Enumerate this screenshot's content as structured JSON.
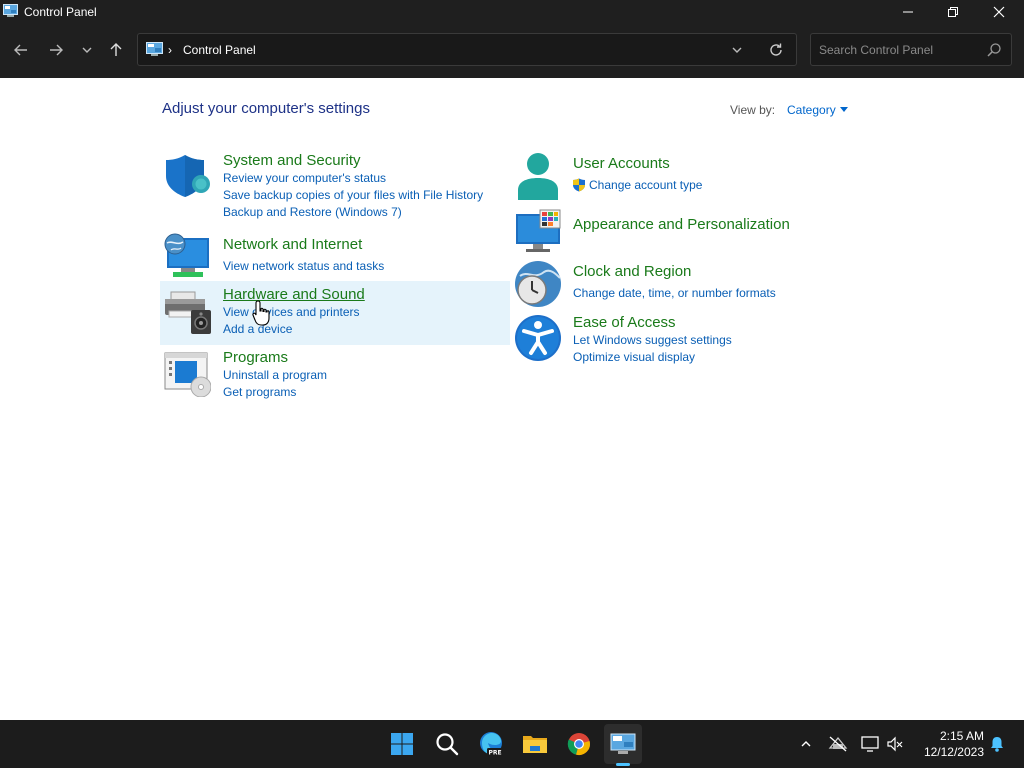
{
  "window": {
    "title": "Control Panel"
  },
  "address": {
    "breadcrumb": "Control Panel",
    "search_placeholder": "Search Control Panel"
  },
  "content": {
    "heading": "Adjust your computer's settings",
    "view_by_label": "View by:",
    "view_by_value": "Category",
    "left_categories": [
      {
        "title": "System and Security",
        "icon": "shield-icon",
        "links": [
          "Review your computer's status",
          "Save backup copies of your files with File History",
          "Backup and Restore (Windows 7)"
        ]
      },
      {
        "title": "Network and Internet",
        "icon": "network-globe-icon",
        "links": [
          "View network status and tasks"
        ]
      },
      {
        "title": "Hardware and Sound",
        "icon": "printer-speaker-icon",
        "links": [
          "View devices and printers",
          "Add a device"
        ]
      },
      {
        "title": "Programs",
        "icon": "programs-disc-icon",
        "links": [
          "Uninstall a program",
          "Get programs"
        ]
      }
    ],
    "right_categories": [
      {
        "title": "User Accounts",
        "icon": "user-icon",
        "links": [
          "Change account type"
        ]
      },
      {
        "title": "Appearance and Personalization",
        "icon": "monitor-palette-icon",
        "links": []
      },
      {
        "title": "Clock and Region",
        "icon": "clock-globe-icon",
        "links": [
          "Change date, time, or number formats"
        ]
      },
      {
        "title": "Ease of Access",
        "icon": "accessibility-icon",
        "links": [
          "Let Windows suggest settings",
          "Optimize visual display"
        ]
      }
    ]
  },
  "taskbar": {
    "apps": [
      "start-icon",
      "search-icon",
      "edge-pre-icon",
      "file-explorer-icon",
      "chrome-icon",
      "control-panel-icon"
    ],
    "time": "2:15 AM",
    "date": "12/12/2023"
  },
  "colors": {
    "title_bar": "#1f1f1f",
    "category_title": "#1a7a1a",
    "link": "#0a5fb5",
    "heading": "#1e3287",
    "hover_bg": "#e5f3fb"
  }
}
